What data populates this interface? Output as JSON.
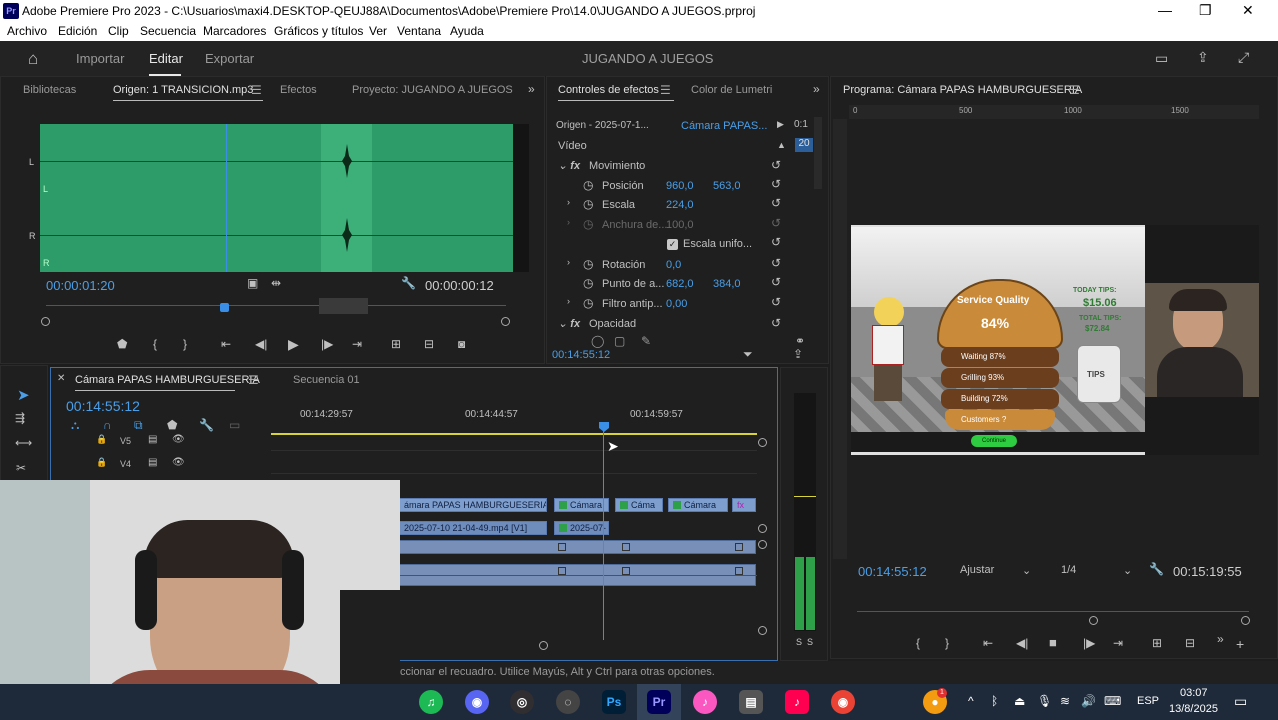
{
  "window": {
    "title": "Adobe Premiere Pro 2023 - C:\\Usuarios\\maxi4.DESKTOP-QEUJ88A\\Documentos\\Adobe\\Premiere Pro\\14.0\\JUGANDO A JUEGOS.prproj",
    "logo": "Pr",
    "minimize": "—",
    "maximize": "❐",
    "close": "✕"
  },
  "menu": [
    "Archivo",
    "Edición",
    "Clip",
    "Secuencia",
    "Marcadores",
    "Gráficos y títulos",
    "Ver",
    "Ventana",
    "Ayuda"
  ],
  "header": {
    "workspaces": [
      "Importar",
      "Editar",
      "Exportar"
    ],
    "active_workspace": "Editar",
    "project_title": "JUGANDO A JUEGOS"
  },
  "source_panel": {
    "tabs": [
      "Bibliotecas",
      "Origen: 1 TRANSICION.mp3",
      "Efectos",
      "Proyecto: JUGANDO A JUEGOS"
    ],
    "active_tab": "Origen: 1 TRANSICION.mp3",
    "timecode_in": "00:00:01:20",
    "timecode_duration": "00:00:00:12",
    "channel_labels": [
      "L",
      "L",
      "R",
      "R"
    ]
  },
  "effect_controls": {
    "tabs": [
      "Controles de efectos",
      "Color de Lumetri"
    ],
    "active_tab": "Controles de efectos",
    "source_label": "Origen - 2025-07-1...",
    "clip_label": "Cámara PAPAS...",
    "mini_time": "0:1",
    "mini_val": "20",
    "section": "Vídeo",
    "groups": [
      "Movimiento",
      "Opacidad"
    ],
    "props": [
      {
        "name": "Posición",
        "v1": "960,0",
        "v2": "563,0"
      },
      {
        "name": "Escala",
        "v1": "224,0",
        "v2": ""
      },
      {
        "name": "Anchura de...",
        "v1": "100,0",
        "v2": ""
      },
      {
        "name": "Escala unifo...",
        "v1": "",
        "v2": ""
      },
      {
        "name": "Rotación",
        "v1": "0,0",
        "v2": ""
      },
      {
        "name": "Punto de a...",
        "v1": "682,0",
        "v2": "384,0"
      },
      {
        "name": "Filtro antip...",
        "v1": "0,00",
        "v2": ""
      }
    ],
    "timecode": "00:14:55:12"
  },
  "program": {
    "title": "Programa: Cámara PAPAS HAMBURGUESERIA",
    "ruler_labels": [
      "0",
      "500",
      "1000",
      "1500"
    ],
    "timecode": "00:14:55:12",
    "fit": "Ajustar",
    "resolution": "1/4",
    "duration": "00:15:19:55",
    "game": {
      "header": "Service Quality",
      "score": "84%",
      "rows": [
        "Waiting 87%",
        "Grilling 93%",
        "Building 72%",
        "Customers ?"
      ],
      "tips_title": "TODAY TIPS:",
      "tips_value": "$15.06",
      "total_title": "TOTAL TIPS:",
      "total_value": "$72.84",
      "jar": "TIPS",
      "button": "Continue"
    }
  },
  "timeline": {
    "tabs": [
      "Cámara PAPAS HAMBURGUESERIA",
      "Secuencia 01"
    ],
    "active_tab": "Cámara PAPAS HAMBURGUESERIA",
    "timecode": "00:14:55:12",
    "ruler_labels": [
      "00:14:29:57",
      "00:14:44:57",
      "00:14:59:57"
    ],
    "tracks": [
      "V5",
      "V4"
    ],
    "clips": [
      {
        "label": "ámara PAPAS HAMBURGUESERIA.MO"
      },
      {
        "label": "Cámara"
      },
      {
        "label": "Cáma"
      },
      {
        "label": "Cámara"
      },
      {
        "label": "fx"
      }
    ],
    "clip_v1": "2025-07-10 21-04-49.mp4 [V1]",
    "clip_v1b": "2025-07-"
  },
  "meter": {
    "labels": [
      "S",
      "S"
    ],
    "level": 0.35
  },
  "status_bar": "ccionar el recuadro. Utilice Mayús, Alt y Ctrl para otras opciones.",
  "taskbar": {
    "lang": "ESP",
    "time": "03:07",
    "date": "13/8/2025",
    "apps": [
      "spotify",
      "discord",
      "obs",
      "chrome-dev",
      "ps",
      "pr",
      "itunes",
      "files",
      "tiktok",
      "chrome"
    ],
    "notification_count": "1"
  },
  "colors": {
    "accent": "#4a9fe8",
    "waveform": "#2e9c68",
    "clip": "#7e9fce",
    "playhead": "#3a8ee6"
  }
}
